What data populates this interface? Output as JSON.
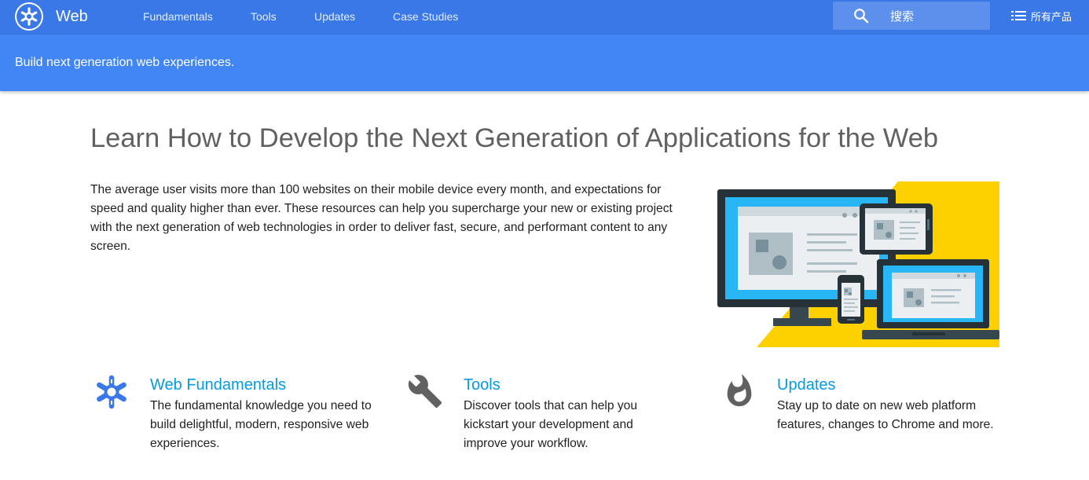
{
  "header": {
    "site_title": "Web",
    "nav": [
      {
        "label": "Fundamentals"
      },
      {
        "label": "Tools"
      },
      {
        "label": "Updates"
      },
      {
        "label": "Case Studies"
      }
    ],
    "search_placeholder": "搜索",
    "all_products_label": "所有产品"
  },
  "banner": {
    "text": "Build next generation web experiences."
  },
  "main": {
    "headline": "Learn How to Develop the Next Generation of Applications for the Web",
    "intro": "The average user visits more than 100 websites on their mobile device every month, and expectations for speed and quality higher than ever. These resources can help you supercharge your new or existing project with the next generation of web technologies in order to deliver fast, secure, and performant content to any screen."
  },
  "cards": [
    {
      "icon": "fundamentals-asterisk-icon",
      "title": "Web Fundamentals",
      "desc": "The fundamental knowledge you need to build delightful, modern, responsive web experiences."
    },
    {
      "icon": "wrench-icon",
      "title": "Tools",
      "desc": "Discover tools that can help you kickstart your development and improve your workflow."
    },
    {
      "icon": "flame-icon",
      "title": "Updates",
      "desc": "Stay up to date on new web platform features, changes to Chrome and more."
    }
  ],
  "colors": {
    "topbar": "#3b78e7",
    "banner": "#4285f4",
    "link": "#039be5",
    "hero_yellow": "#fdd000",
    "hero_screen": "#29b6f6"
  }
}
